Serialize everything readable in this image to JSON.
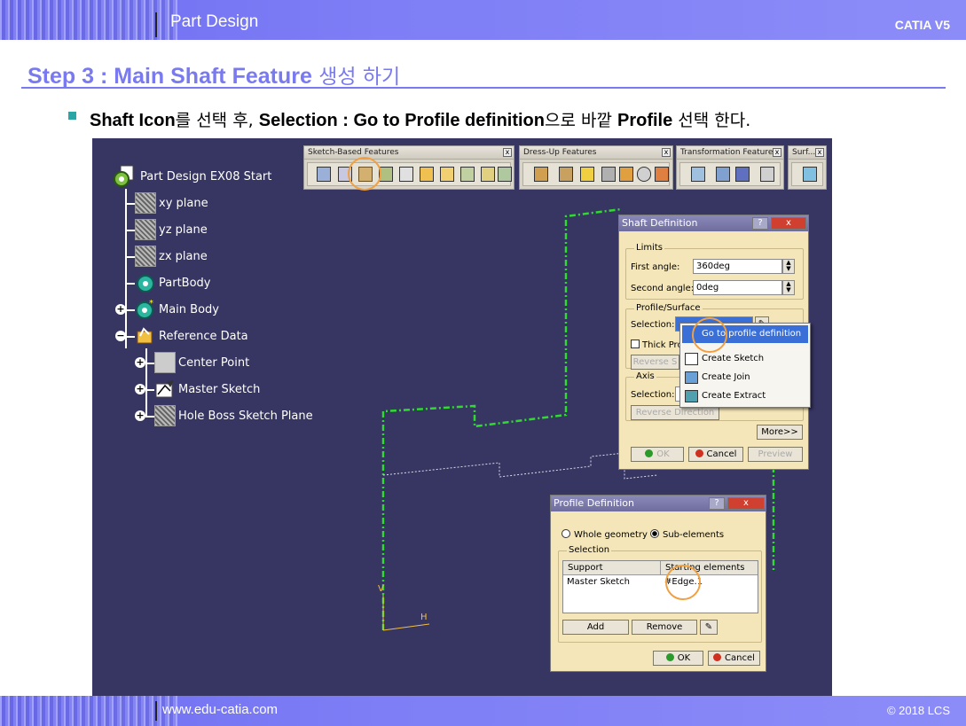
{
  "header": {
    "title": "Part Design",
    "product": "CATIA V5"
  },
  "footer": {
    "url": "www.edu-catia.com",
    "copyright": "© 2018 LCS"
  },
  "step": {
    "title_en": "Step 3 : Main Shaft Feature",
    "title_ko": " 생성 하기"
  },
  "instruction": {
    "p1": "Shaft Icon",
    "p2": "를 선택 후, ",
    "p3": "Selection : Go to Profile definition",
    "p4": "으로 바깥 ",
    "p5": "Profile",
    "p6": " 선택 한다."
  },
  "tree": {
    "root": "Part Design EX08 Start",
    "items": [
      "xy plane",
      "yz plane",
      "zx plane",
      "PartBody",
      "Main Body",
      "Reference Data",
      "Center Point",
      "Master Sketch",
      "Hole Boss Sketch Plane"
    ]
  },
  "toolbars": {
    "sketch_based": "Sketch-Based Features",
    "dress_up": "Dress-Up Features",
    "transformation": "Transformation Features",
    "surface": "Surf..."
  },
  "shaft_dialog": {
    "title": "Shaft Definition",
    "limits": "Limits",
    "first_angle_label": "First angle:",
    "first_angle_value": "360deg",
    "second_angle_label": "Second angle:",
    "second_angle_value": "0deg",
    "profile_group": "Profile/Surface",
    "selection_label": "Selection:",
    "thick_label": "Thick Pro",
    "reverse_side": "Reverse S",
    "axis_group": "Axis",
    "axis_selection_label": "Selection:",
    "reverse_direction": "Reverse Direction",
    "more": "More>>",
    "ok": "OK",
    "cancel": "Cancel",
    "preview": "Preview"
  },
  "context_menu": {
    "items": [
      "Go to profile definition",
      "Create Sketch",
      "Create Join",
      "Create Extract"
    ]
  },
  "profile_dialog": {
    "title": "Profile Definition",
    "whole_geometry": "Whole geometry",
    "sub_elements": "Sub-elements",
    "selection_group": "Selection",
    "col_support": "Support",
    "col_starting": "Starting elements",
    "row_support": "Master Sketch",
    "row_starting": "#Edge.1",
    "add": "Add",
    "remove": "Remove",
    "ok": "OK",
    "cancel": "Cancel"
  },
  "axes": {
    "v": "V",
    "h": "H"
  },
  "colors": {
    "band": "#7a7af0",
    "viewer_bg": "#373562",
    "profile_green": "#2edb2e",
    "highlight_ring": "#f0a040"
  }
}
